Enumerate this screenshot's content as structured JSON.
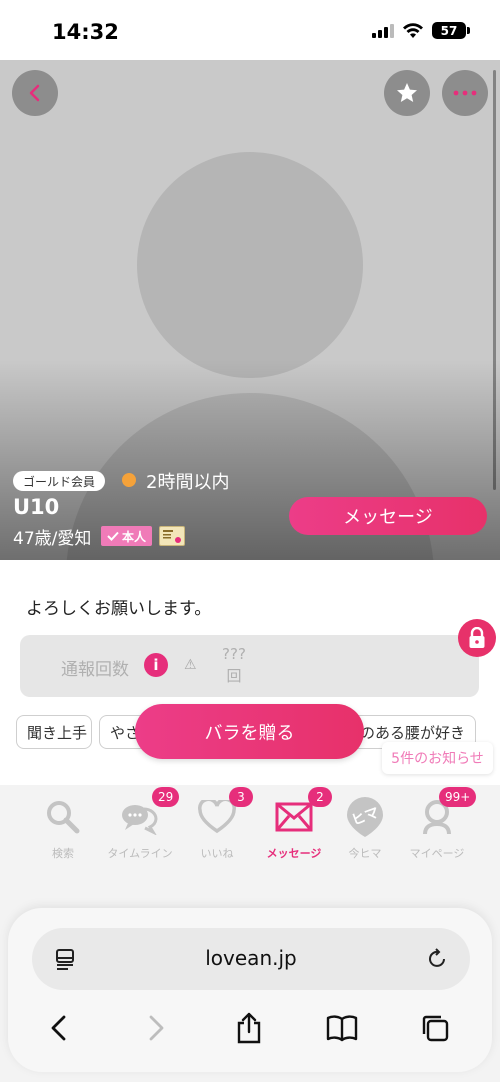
{
  "status": {
    "time": "14:32",
    "battery": "57"
  },
  "profile": {
    "member_badge": "ゴールド会員",
    "online_status": "2時間以内",
    "name": "U10",
    "age_area": "47歳/愛知",
    "verified_label": "本人",
    "message_button": "メッセージ",
    "greeting": "よろしくお願いします。",
    "report_label": "通報回数",
    "report_value_line1": "???",
    "report_value_line2": "回",
    "tags": [
      "聞き上手",
      "やさ",
      "のある腰が好き"
    ],
    "rose_button": "バラを贈る"
  },
  "notice": "5件のお知らせ",
  "nav": {
    "items": [
      {
        "label": "検索",
        "badge": "",
        "active": false
      },
      {
        "label": "タイムライン",
        "badge": "29",
        "active": false
      },
      {
        "label": "いいね",
        "badge": "3",
        "active": false
      },
      {
        "label": "メッセージ",
        "badge": "2",
        "active": true
      },
      {
        "label": "今ヒマ",
        "badge": "",
        "active": false
      },
      {
        "label": "マイページ",
        "badge": "99+",
        "active": false
      }
    ],
    "hima_icon_text": "ヒマ"
  },
  "browser": {
    "url": "lovean.jp"
  },
  "colors": {
    "accent": "#e62e7b",
    "online": "#f5a23a",
    "verify": "#f07bb8"
  }
}
